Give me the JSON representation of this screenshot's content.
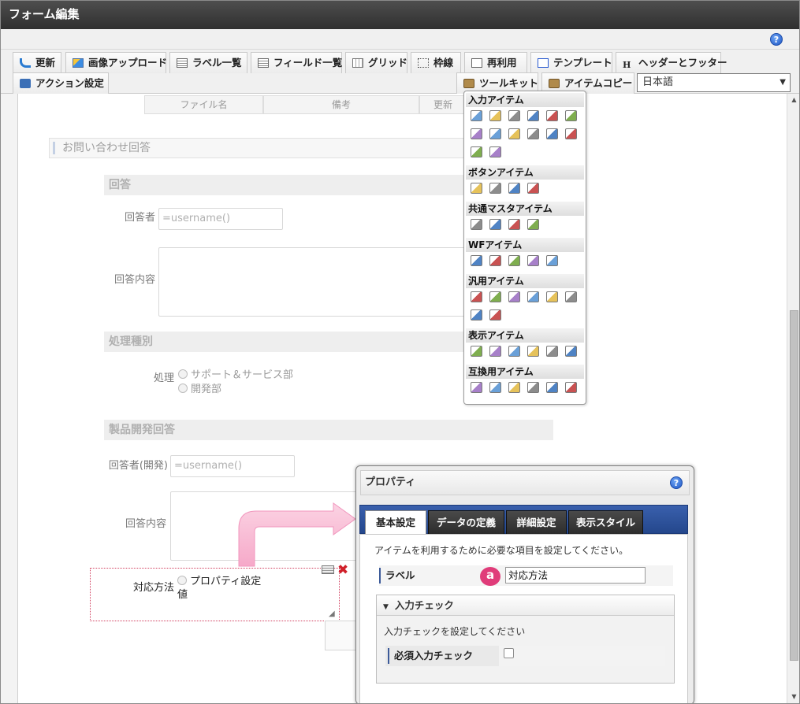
{
  "window": {
    "title": "フォーム編集"
  },
  "toolbar": {
    "row1": [
      "更新",
      "画像アップロード",
      "ラベル一覧",
      "フィールド一覧",
      "グリッド",
      "枠線",
      "再利用",
      "テンプレート",
      "ヘッダーとフッター"
    ],
    "action": "アクション設定",
    "toolkit": "ツールキット",
    "itemcopy": "アイテムコピー",
    "language": "日本語"
  },
  "table_header": [
    "ファイル名",
    "備考",
    "更新"
  ],
  "form": {
    "section": "お問い合わせ回答",
    "answer": {
      "heading": "回答",
      "respondent_label": "回答者",
      "respondent_placeholder": "=username()",
      "content_label": "回答内容"
    },
    "processing": {
      "heading": "処理種別",
      "label": "処理",
      "options": [
        "サポート＆サービス部",
        "開発部"
      ]
    },
    "dev": {
      "heading": "製品開発回答",
      "respondent_label": "回答者(開発)",
      "respondent_placeholder": "=username()",
      "content_label": "回答内容"
    },
    "selected_item": {
      "label": "対応方法",
      "option_line1": "プロパティ設定",
      "option_line2": "値"
    }
  },
  "palette": {
    "groups": [
      {
        "title": "入力アイテム",
        "count": 14
      },
      {
        "title": "ボタンアイテム",
        "count": 4
      },
      {
        "title": "共通マスタアイテム",
        "count": 4
      },
      {
        "title": "WFアイテム",
        "count": 5
      },
      {
        "title": "汎用アイテム",
        "count": 8
      },
      {
        "title": "表示アイテム",
        "count": 6
      },
      {
        "title": "互換用アイテム",
        "count": 6
      }
    ]
  },
  "properties": {
    "title": "プロパティ",
    "tabs": [
      "基本設定",
      "データの定義",
      "詳細設定",
      "表示スタイル"
    ],
    "active_tab": 0,
    "description": "アイテムを利用するために必要な項目を設定してください。",
    "label_field": {
      "label": "ラベル",
      "badge": "a",
      "value": "対応方法"
    },
    "input_check": {
      "heading": "入力チェック",
      "description": "入力チェックを設定してください",
      "required_label": "必須入力チェック",
      "required_checked": false
    }
  },
  "colors": {
    "accent": "#e03c7a",
    "tab_bar": "#2c4f98",
    "title_bar": "#3a3a3a"
  }
}
